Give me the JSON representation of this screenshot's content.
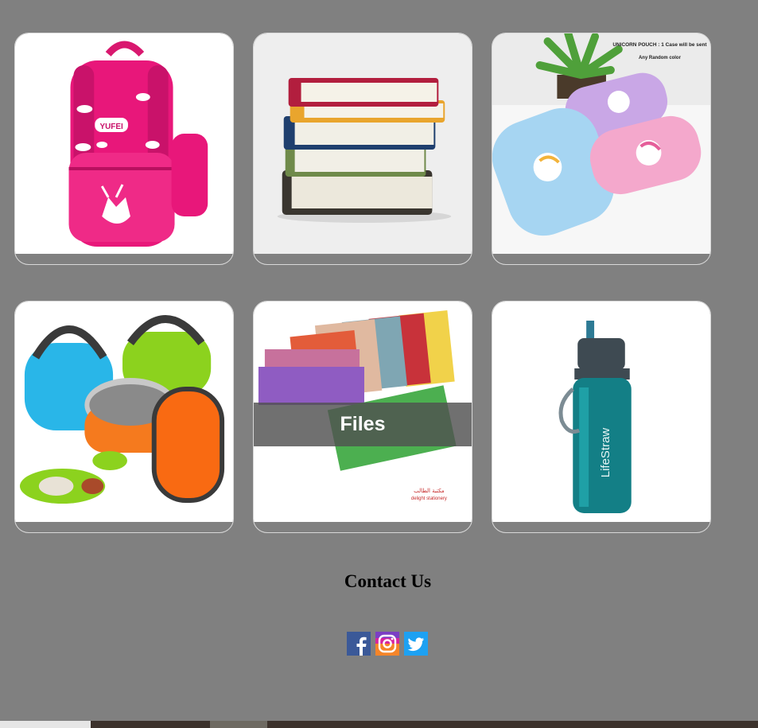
{
  "products": [
    {
      "name": "School Backpack",
      "image_text": "YUFEI",
      "overlay": ""
    },
    {
      "name": "Books",
      "overlay": ""
    },
    {
      "name": "Pencil Cases",
      "image_text": "UNICORN POUCH : 1 Case will be sent",
      "image_subtext": "Any Random color",
      "overlay": ""
    },
    {
      "name": "Lunch Boxes",
      "overlay": ""
    },
    {
      "name": "Files",
      "overlay": "Files",
      "image_text_ar": "مكتبة الطالب",
      "image_text": "delight stationery"
    },
    {
      "name": "Water Bottle",
      "image_text": "LifeStraw",
      "overlay": ""
    }
  ],
  "contact": {
    "title": "Contact Us"
  },
  "social": [
    {
      "icon": "facebook-icon",
      "color": "#3b5998"
    },
    {
      "icon": "instagram-icon",
      "color": "#e1306c"
    },
    {
      "icon": "twitter-icon",
      "color": "#1da1f2"
    }
  ]
}
